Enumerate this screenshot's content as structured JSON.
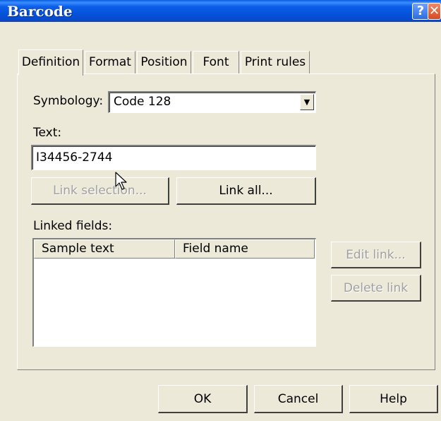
{
  "window": {
    "title": "Barcode",
    "help_glyph": "?",
    "close_glyph": "✕"
  },
  "tabs": [
    {
      "label": "Definition",
      "active": true
    },
    {
      "label": "Format",
      "active": false
    },
    {
      "label": "Position",
      "active": false
    },
    {
      "label": "Font",
      "active": false
    },
    {
      "label": "Print rules",
      "active": false
    }
  ],
  "definition": {
    "symbology_label": "Symbology:",
    "symbology_value": "Code 128",
    "text_label": "Text:",
    "text_value": "I34456-2744",
    "link_selection_label": "Link selection...",
    "link_all_label": "Link all...",
    "linked_fields_label": "Linked fields:",
    "columns": [
      "Sample text",
      "Field name"
    ],
    "rows": [],
    "edit_link_label": "Edit link...",
    "delete_link_label": "Delete link"
  },
  "footer": {
    "ok_label": "OK",
    "cancel_label": "Cancel",
    "help_label": "Help"
  },
  "icons": {
    "dropdown": "chevron-down-icon",
    "cursor": "mouse-pointer-icon"
  },
  "colors": {
    "titlebar": "#0550d8",
    "dialog_bg": "#ece9d8",
    "close_button": "#d64a22"
  }
}
